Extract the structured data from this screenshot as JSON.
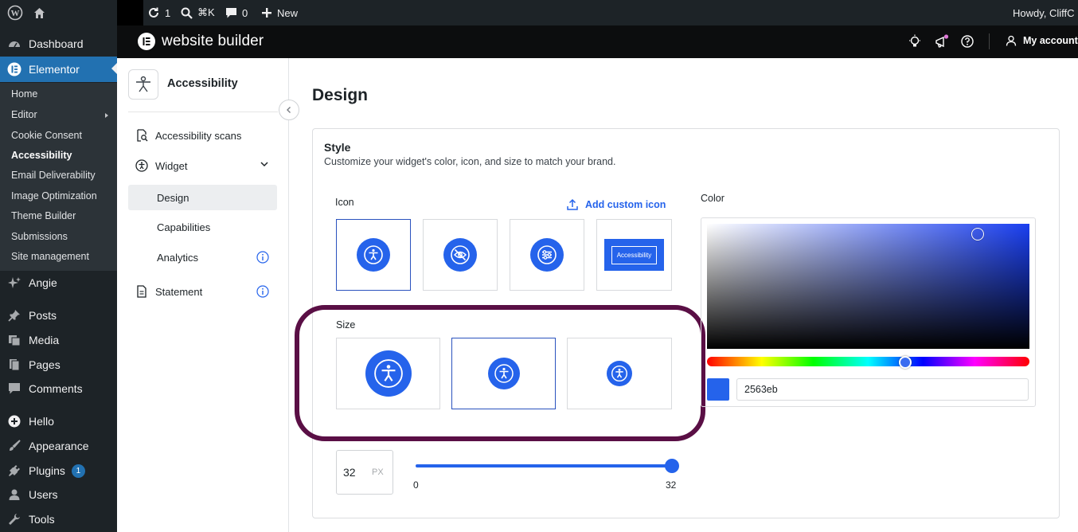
{
  "admin_bar": {
    "updates_count": "1",
    "search_shortcut": "⌘K",
    "comments_count": "0",
    "new_label": "New",
    "greeting": "Howdy, CliffC"
  },
  "sidebar": {
    "dashboard": "Dashboard",
    "elementor": "Elementor",
    "submenu": [
      "Home",
      "Editor",
      "Cookie Consent",
      "Accessibility",
      "Email Deliverability",
      "Image Optimization",
      "Theme Builder",
      "Submissions",
      "Site management"
    ],
    "angie": "Angie",
    "posts": "Posts",
    "media": "Media",
    "pages": "Pages",
    "comments": "Comments",
    "hello": "Hello",
    "appearance": "Appearance",
    "plugins": "Plugins",
    "plugins_badge": "1",
    "users": "Users",
    "tools": "Tools"
  },
  "header": {
    "title": "website builder",
    "account": "My account"
  },
  "subnav": {
    "title": "Accessibility",
    "items": {
      "scans": "Accessibility scans",
      "widget": "Widget",
      "design": "Design",
      "capabilities": "Capabilities",
      "analytics": "Analytics",
      "statement": "Statement"
    }
  },
  "main": {
    "page_title": "Design",
    "style_title": "Style",
    "style_desc": "Customize your widget's color, icon, and size to match your brand.",
    "icon_label": "Icon",
    "add_custom_icon": "Add custom icon",
    "accessibility_button_text": "Accessibility",
    "size_label": "Size",
    "size_value": "32",
    "size_unit": "PX",
    "slider_min": "0",
    "slider_max": "32",
    "color_label": "Color",
    "hex_value": "2563eb"
  },
  "colors": {
    "accent": "#2563eb",
    "wp_blue": "#2271b1",
    "highlight_ring": "#5a0f45"
  }
}
